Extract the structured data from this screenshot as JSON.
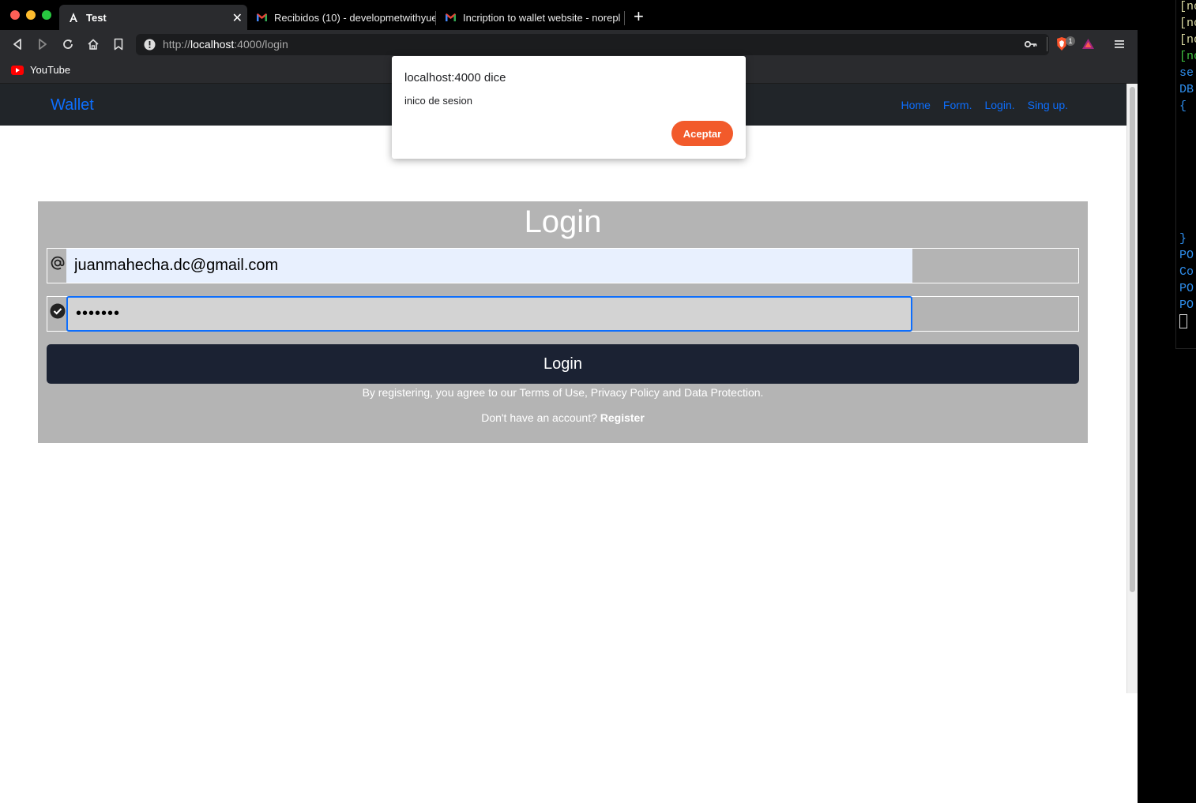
{
  "browser": {
    "tabs": [
      {
        "title": "Test",
        "active": true,
        "icon": "angular-icon"
      },
      {
        "title": "Recibidos (10) - developmetwithyue",
        "active": false,
        "icon": "gmail-icon"
      },
      {
        "title": "Incription to wallet website - norepl",
        "active": false,
        "icon": "gmail-icon"
      }
    ],
    "new_tab": "+",
    "url_prefix": "http://",
    "url_host": "localhost",
    "url_rest": ":4000/login",
    "bookmarks": [
      {
        "label": "YouTube",
        "icon": "youtube-icon"
      }
    ],
    "shield_count": "1"
  },
  "navbar": {
    "brand": "Wallet",
    "links": [
      "Home",
      "Form.",
      "Login.",
      "Sing up."
    ]
  },
  "login": {
    "title": "Login",
    "email_value": "juanmahecha.dc@gmail.com",
    "password_mask": "•••••••",
    "button": "Login",
    "terms": "By registering, you agree to our Terms of Use, Privacy Policy and Data Protection.",
    "no_account": "Don't have an account?",
    "register": "Register"
  },
  "dialog": {
    "title": "localhost:4000 dice",
    "message": "inico de sesion",
    "button": "Aceptar"
  },
  "terminal": {
    "lines": [
      {
        "text": "[no",
        "color": "#d7d7a0"
      },
      {
        "text": "[no",
        "color": "#d7d7a0"
      },
      {
        "text": "[no",
        "color": "#d7d7a0"
      },
      {
        "text": "[no",
        "color": "#3fbf3f"
      },
      {
        "text": "se",
        "color": "#2f8fef"
      },
      {
        "text": "DB",
        "color": "#2f8fef"
      },
      {
        "text": "{",
        "color": "#2f8fef"
      },
      {
        "text": "  ",
        "color": "#2f8fef"
      },
      {
        "text": "  ",
        "color": "#2f8fef"
      },
      {
        "text": "  ",
        "color": "#2f8fef"
      },
      {
        "text": "  ",
        "color": "#2f8fef"
      },
      {
        "text": "  ",
        "color": "#2f8fef"
      },
      {
        "text": "  ",
        "color": "#2f8fef"
      },
      {
        "text": "  ",
        "color": "#2f8fef"
      },
      {
        "text": "}",
        "color": "#2f8fef"
      },
      {
        "text": "PO",
        "color": "#2f8fef"
      },
      {
        "text": "Co",
        "color": "#2f8fef"
      },
      {
        "text": "PO",
        "color": "#2f8fef"
      },
      {
        "text": "PO",
        "color": "#2f8fef"
      }
    ]
  },
  "colors": {
    "accent": "#0d6efd",
    "dialog_button": "#f25a2b",
    "card": "#b4b4b4",
    "login_button": "#1b2233"
  }
}
